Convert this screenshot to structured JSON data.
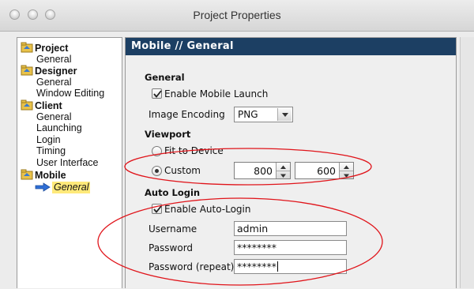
{
  "window": {
    "title": "Project Properties",
    "header": "Mobile // General"
  },
  "sidebar": {
    "groups": [
      {
        "label": "Project",
        "items": [
          "General"
        ]
      },
      {
        "label": "Designer",
        "items": [
          "General",
          "Window Editing"
        ]
      },
      {
        "label": "Client",
        "items": [
          "General",
          "Launching",
          "Login",
          "Timing",
          "User Interface"
        ]
      },
      {
        "label": "Mobile",
        "items": [
          "General"
        ]
      }
    ],
    "selected": "Mobile/General"
  },
  "general": {
    "title": "General",
    "enable_mobile_launch": {
      "label": "Enable Mobile Launch",
      "checked": true
    },
    "image_encoding": {
      "label": "Image Encoding",
      "value": "PNG"
    }
  },
  "viewport": {
    "title": "Viewport",
    "fit_label": "Fit to Device",
    "custom_label": "Custom",
    "selected": "custom",
    "width": "800",
    "height": "600"
  },
  "auto_login": {
    "title": "Auto Login",
    "enable": {
      "label": "Enable Auto-Login",
      "checked": true
    },
    "username_label": "Username",
    "username": "admin",
    "password_label": "Password",
    "password": "********",
    "password_repeat_label": "Password (repeat)",
    "password_repeat": "********"
  },
  "annotation_color": "#e0141a"
}
